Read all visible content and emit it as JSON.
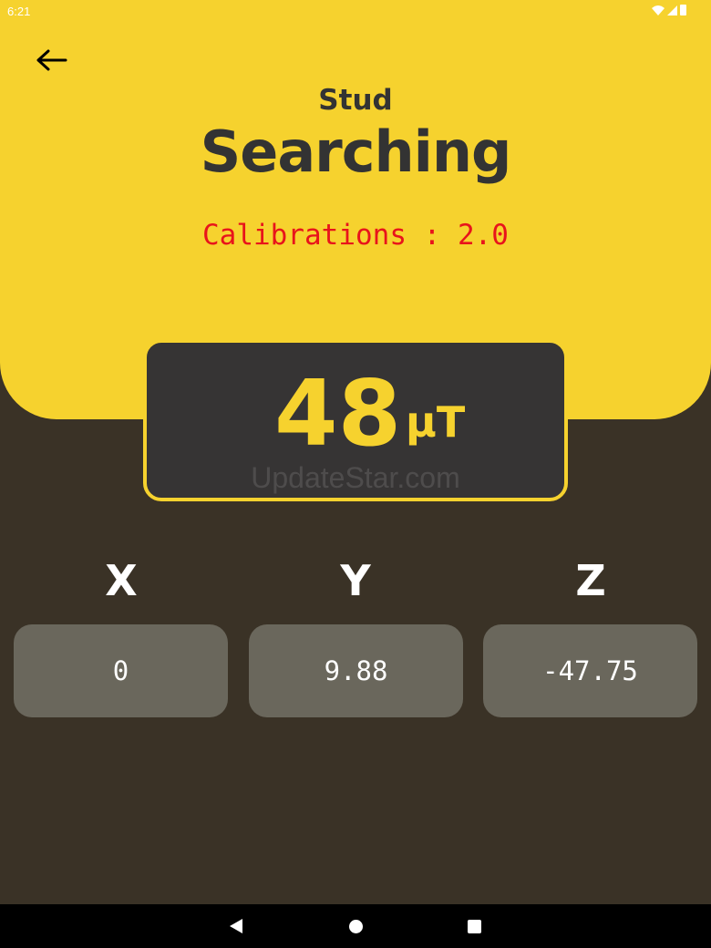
{
  "status_bar": {
    "time": "6:21",
    "icons": [
      "wifi-icon",
      "signal-icon",
      "battery-icon"
    ]
  },
  "header": {
    "back_icon": "arrow-left-icon",
    "title_small": "Stud",
    "title_large": "Searching",
    "calibration": "Calibrations : 2.0"
  },
  "reading": {
    "value": "48",
    "unit": "µT",
    "watermark": "UpdateStar.com"
  },
  "axes": [
    {
      "label": "X",
      "value": "0"
    },
    {
      "label": "Y",
      "value": "9.88"
    },
    {
      "label": "Z",
      "value": "-47.75"
    }
  ],
  "nav_bar": {
    "buttons": [
      "back-nav-icon",
      "home-nav-icon",
      "recents-nav-icon"
    ]
  },
  "colors": {
    "accent_yellow": "#f6d22e",
    "background_dark": "#3a3226",
    "reading_box": "#363434",
    "axis_box": "#6a675c",
    "calibration_red": "#e8141b",
    "title_text": "#333333"
  }
}
